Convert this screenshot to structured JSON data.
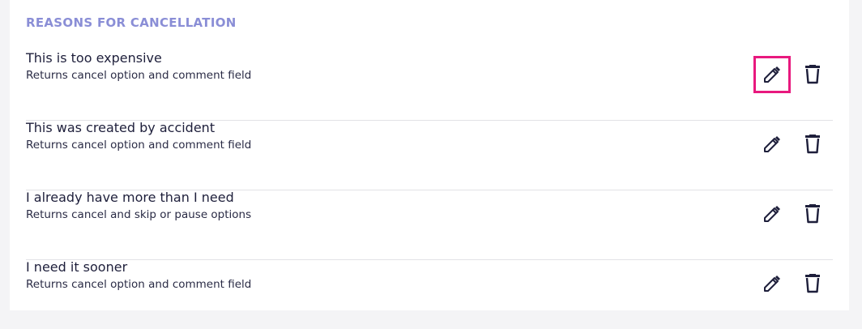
{
  "section": {
    "title": "REASONS FOR CANCELLATION"
  },
  "colors": {
    "section_title": "#8a8ed6",
    "text": "#1e1f3b",
    "divider": "#e2e2e6",
    "highlight": "#e8197e"
  },
  "icons": {
    "edit": "pencil-icon",
    "delete": "trash-icon"
  },
  "reasons": [
    {
      "title": "This is too expensive",
      "description": "Returns cancel option and comment field",
      "edit_highlighted": true
    },
    {
      "title": "This was created by accident",
      "description": "Returns cancel option and comment field",
      "edit_highlighted": false
    },
    {
      "title": "I already have more than I need",
      "description": "Returns cancel and skip or pause options",
      "edit_highlighted": false
    },
    {
      "title": "I need it sooner",
      "description": "Returns cancel option and comment field",
      "edit_highlighted": false
    }
  ]
}
